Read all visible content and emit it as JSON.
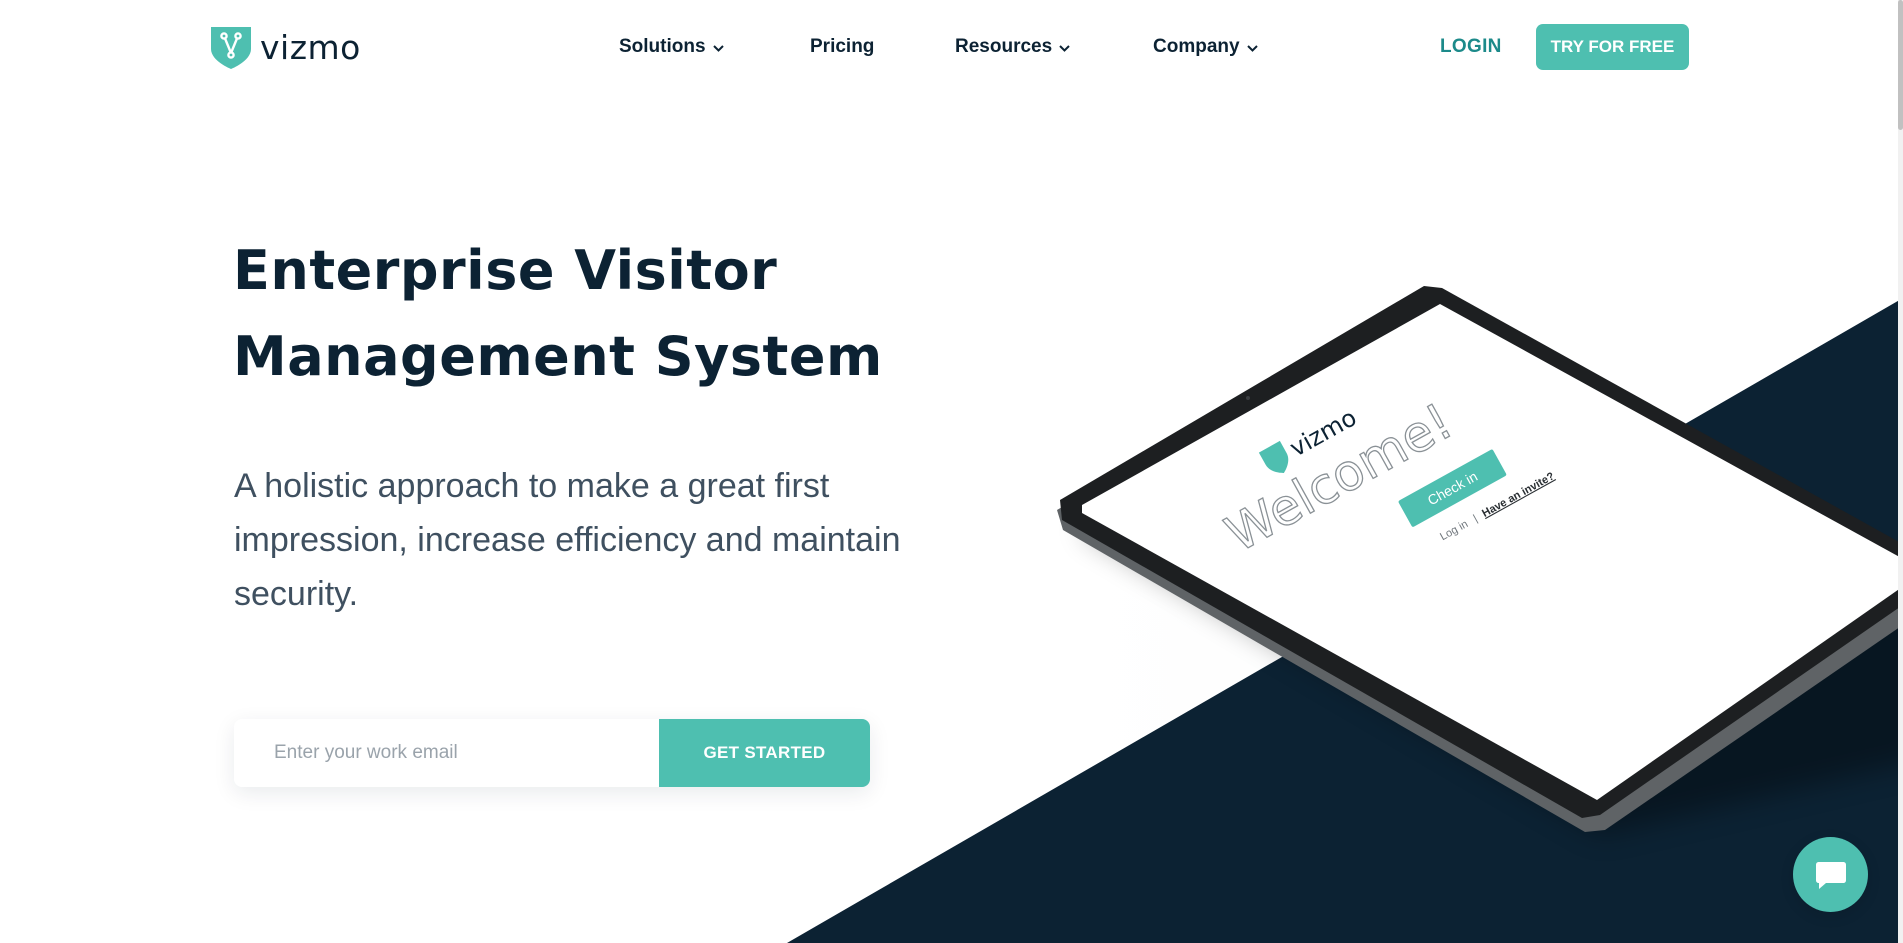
{
  "colors": {
    "brand_teal": "#4ebfb0",
    "login_teal": "#1c8a8a",
    "navy": "#0c2233",
    "text_gray": "#3f5060"
  },
  "header": {
    "logo_text": "vizmo",
    "logo_icon": "shield-branch-icon",
    "nav": [
      {
        "label": "Solutions",
        "has_dropdown": true
      },
      {
        "label": "Pricing",
        "has_dropdown": false
      },
      {
        "label": "Resources",
        "has_dropdown": true
      },
      {
        "label": "Company",
        "has_dropdown": true
      }
    ],
    "login_label": "LOGIN",
    "cta_label": "TRY FOR FREE"
  },
  "hero": {
    "title_line1": "Enterprise Visitor",
    "title_line2": "Management System",
    "subtitle": "A holistic approach to make a great first impression, increase efficiency and maintain security.",
    "email_placeholder": "Enter your work email",
    "email_value": "",
    "cta_label": "GET STARTED"
  },
  "tablet_screen": {
    "logo_text": "vizmo",
    "welcome": "Welcome!",
    "checkin_label": "Check in",
    "login_link": "Log in",
    "separator": "|",
    "invite_link": "Have an invite?"
  },
  "chat": {
    "icon": "chat-bubble-icon"
  }
}
